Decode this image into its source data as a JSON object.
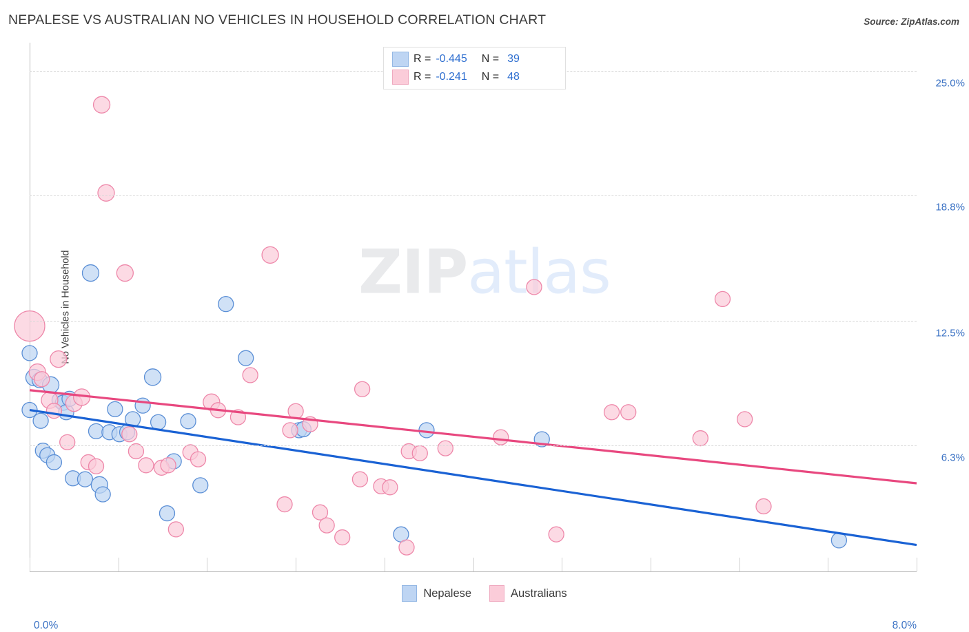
{
  "header": {
    "title": "NEPALESE VS AUSTRALIAN NO VEHICLES IN HOUSEHOLD CORRELATION CHART",
    "source": "Source: ZipAtlas.com"
  },
  "legend_stats": {
    "rows": [
      {
        "series": "Nepalese",
        "r_label": "R =",
        "r_value": "-0.445",
        "n_label": "N =",
        "n_value": "39",
        "color": "#bed5f3"
      },
      {
        "series": "Australians",
        "r_label": "R =",
        "r_value": "-0.241",
        "n_label": "N =",
        "n_value": "48",
        "color": "#fbccd9"
      }
    ]
  },
  "bottom_legend": {
    "items": [
      {
        "label": "Nepalese",
        "color": "#bed5f3"
      },
      {
        "label": "Australians",
        "color": "#fbccd9"
      }
    ]
  },
  "watermark": {
    "part1": "ZIP",
    "part2": "atlas"
  },
  "axes": {
    "y_title": "No Vehicles in Household",
    "y_ticks": [
      "25.0%",
      "18.8%",
      "12.5%",
      "6.3%"
    ],
    "x_min_label": "0.0%",
    "x_max_label": "8.0%"
  },
  "chart_data": {
    "type": "scatter",
    "title": "NEPALESE VS AUSTRALIAN NO VEHICLES IN HOUSEHOLD CORRELATION CHART",
    "xlabel": "",
    "ylabel": "No Vehicles in Household",
    "xlim": [
      0.0,
      8.0
    ],
    "ylim": [
      0.0,
      26.4
    ],
    "x_tick_values": [
      0.0,
      0.8,
      1.6,
      2.4,
      3.2,
      4.0,
      4.8,
      5.6,
      6.4,
      7.2,
      8.0
    ],
    "y_tick_values": [
      25.0,
      18.8,
      12.5,
      6.3
    ],
    "grid": "horizontal-dashed",
    "legend_position": "bottom-center",
    "series": [
      {
        "name": "Nepalese",
        "color": "#bed5f3",
        "stroke": "#5b8fd6",
        "R": -0.445,
        "N": 39,
        "trendline": {
          "x1": 0.0,
          "y1": 8.06,
          "x2": 8.0,
          "y2": 1.32,
          "color": "#1a62d4"
        },
        "points": [
          {
            "x": 0.0,
            "y": 10.9,
            "r": 11
          },
          {
            "x": 0.0,
            "y": 8.06,
            "r": 11
          },
          {
            "x": 0.04,
            "y": 9.68,
            "r": 12
          },
          {
            "x": 0.09,
            "y": 9.55,
            "r": 11
          },
          {
            "x": 0.1,
            "y": 7.52,
            "r": 11
          },
          {
            "x": 0.12,
            "y": 6.03,
            "r": 11
          },
          {
            "x": 0.16,
            "y": 5.8,
            "r": 11
          },
          {
            "x": 0.19,
            "y": 9.31,
            "r": 12
          },
          {
            "x": 0.22,
            "y": 5.45,
            "r": 11
          },
          {
            "x": 0.27,
            "y": 8.55,
            "r": 11
          },
          {
            "x": 0.3,
            "y": 8.42,
            "r": 11
          },
          {
            "x": 0.33,
            "y": 7.95,
            "r": 11
          },
          {
            "x": 0.36,
            "y": 8.62,
            "r": 11
          },
          {
            "x": 0.39,
            "y": 4.65,
            "r": 11
          },
          {
            "x": 0.5,
            "y": 4.6,
            "r": 11
          },
          {
            "x": 0.55,
            "y": 14.9,
            "r": 12
          },
          {
            "x": 0.6,
            "y": 7.0,
            "r": 11
          },
          {
            "x": 0.63,
            "y": 4.32,
            "r": 12
          },
          {
            "x": 0.66,
            "y": 3.85,
            "r": 11
          },
          {
            "x": 0.72,
            "y": 6.95,
            "r": 11
          },
          {
            "x": 0.77,
            "y": 8.1,
            "r": 11
          },
          {
            "x": 0.81,
            "y": 6.85,
            "r": 11
          },
          {
            "x": 0.88,
            "y": 6.95,
            "r": 11
          },
          {
            "x": 0.93,
            "y": 7.6,
            "r": 11
          },
          {
            "x": 1.02,
            "y": 8.28,
            "r": 11
          },
          {
            "x": 1.11,
            "y": 9.7,
            "r": 12
          },
          {
            "x": 1.16,
            "y": 7.45,
            "r": 11
          },
          {
            "x": 1.24,
            "y": 2.9,
            "r": 11
          },
          {
            "x": 1.3,
            "y": 5.5,
            "r": 11
          },
          {
            "x": 1.43,
            "y": 7.5,
            "r": 11
          },
          {
            "x": 1.54,
            "y": 4.3,
            "r": 11
          },
          {
            "x": 1.77,
            "y": 13.35,
            "r": 11
          },
          {
            "x": 1.95,
            "y": 10.65,
            "r": 11
          },
          {
            "x": 2.43,
            "y": 7.05,
            "r": 11
          },
          {
            "x": 2.47,
            "y": 7.1,
            "r": 11
          },
          {
            "x": 3.35,
            "y": 1.85,
            "r": 11
          },
          {
            "x": 3.58,
            "y": 7.05,
            "r": 11
          },
          {
            "x": 4.62,
            "y": 6.6,
            "r": 11
          },
          {
            "x": 7.3,
            "y": 1.55,
            "r": 11
          }
        ]
      },
      {
        "name": "Australians",
        "color": "#fbccd9",
        "stroke": "#ee88aa",
        "R": -0.241,
        "N": 48,
        "trendline": {
          "x1": 0.0,
          "y1": 9.05,
          "x2": 8.0,
          "y2": 4.4,
          "color": "#e8487f"
        },
        "points": [
          {
            "x": 0.0,
            "y": 12.25,
            "r": 22
          },
          {
            "x": 0.07,
            "y": 9.95,
            "r": 12
          },
          {
            "x": 0.11,
            "y": 9.6,
            "r": 11
          },
          {
            "x": 0.18,
            "y": 8.55,
            "r": 12
          },
          {
            "x": 0.22,
            "y": 8.02,
            "r": 11
          },
          {
            "x": 0.26,
            "y": 10.6,
            "r": 12
          },
          {
            "x": 0.34,
            "y": 6.45,
            "r": 11
          },
          {
            "x": 0.4,
            "y": 8.4,
            "r": 12
          },
          {
            "x": 0.47,
            "y": 8.7,
            "r": 12
          },
          {
            "x": 0.53,
            "y": 5.45,
            "r": 11
          },
          {
            "x": 0.6,
            "y": 5.25,
            "r": 11
          },
          {
            "x": 0.65,
            "y": 23.3,
            "r": 12
          },
          {
            "x": 0.69,
            "y": 18.9,
            "r": 12
          },
          {
            "x": 0.86,
            "y": 14.9,
            "r": 12
          },
          {
            "x": 0.9,
            "y": 6.85,
            "r": 11
          },
          {
            "x": 0.96,
            "y": 6.0,
            "r": 11
          },
          {
            "x": 1.05,
            "y": 5.3,
            "r": 11
          },
          {
            "x": 1.19,
            "y": 5.18,
            "r": 11
          },
          {
            "x": 1.25,
            "y": 5.3,
            "r": 11
          },
          {
            "x": 1.32,
            "y": 2.1,
            "r": 11
          },
          {
            "x": 1.45,
            "y": 5.95,
            "r": 11
          },
          {
            "x": 1.52,
            "y": 5.6,
            "r": 11
          },
          {
            "x": 1.64,
            "y": 8.45,
            "r": 12
          },
          {
            "x": 1.7,
            "y": 8.05,
            "r": 11
          },
          {
            "x": 1.88,
            "y": 7.7,
            "r": 11
          },
          {
            "x": 1.99,
            "y": 9.8,
            "r": 11
          },
          {
            "x": 2.17,
            "y": 15.8,
            "r": 12
          },
          {
            "x": 2.3,
            "y": 3.35,
            "r": 11
          },
          {
            "x": 2.35,
            "y": 7.05,
            "r": 11
          },
          {
            "x": 2.4,
            "y": 8.0,
            "r": 11
          },
          {
            "x": 2.53,
            "y": 7.35,
            "r": 11
          },
          {
            "x": 2.62,
            "y": 2.95,
            "r": 11
          },
          {
            "x": 2.68,
            "y": 2.3,
            "r": 11
          },
          {
            "x": 2.82,
            "y": 1.7,
            "r": 11
          },
          {
            "x": 2.98,
            "y": 4.6,
            "r": 11
          },
          {
            "x": 3.0,
            "y": 9.1,
            "r": 11
          },
          {
            "x": 3.17,
            "y": 4.25,
            "r": 11
          },
          {
            "x": 3.25,
            "y": 4.2,
            "r": 11
          },
          {
            "x": 3.4,
            "y": 1.2,
            "r": 11
          },
          {
            "x": 3.42,
            "y": 6.0,
            "r": 11
          },
          {
            "x": 3.52,
            "y": 5.9,
            "r": 11
          },
          {
            "x": 3.75,
            "y": 6.15,
            "r": 11
          },
          {
            "x": 4.25,
            "y": 6.7,
            "r": 11
          },
          {
            "x": 4.55,
            "y": 14.2,
            "r": 11
          },
          {
            "x": 4.75,
            "y": 1.85,
            "r": 11
          },
          {
            "x": 5.25,
            "y": 7.95,
            "r": 11
          },
          {
            "x": 5.4,
            "y": 7.95,
            "r": 11
          },
          {
            "x": 6.25,
            "y": 13.6,
            "r": 11
          },
          {
            "x": 6.05,
            "y": 6.65,
            "r": 11
          },
          {
            "x": 6.45,
            "y": 7.6,
            "r": 11
          },
          {
            "x": 6.62,
            "y": 3.25,
            "r": 11
          }
        ]
      }
    ]
  }
}
